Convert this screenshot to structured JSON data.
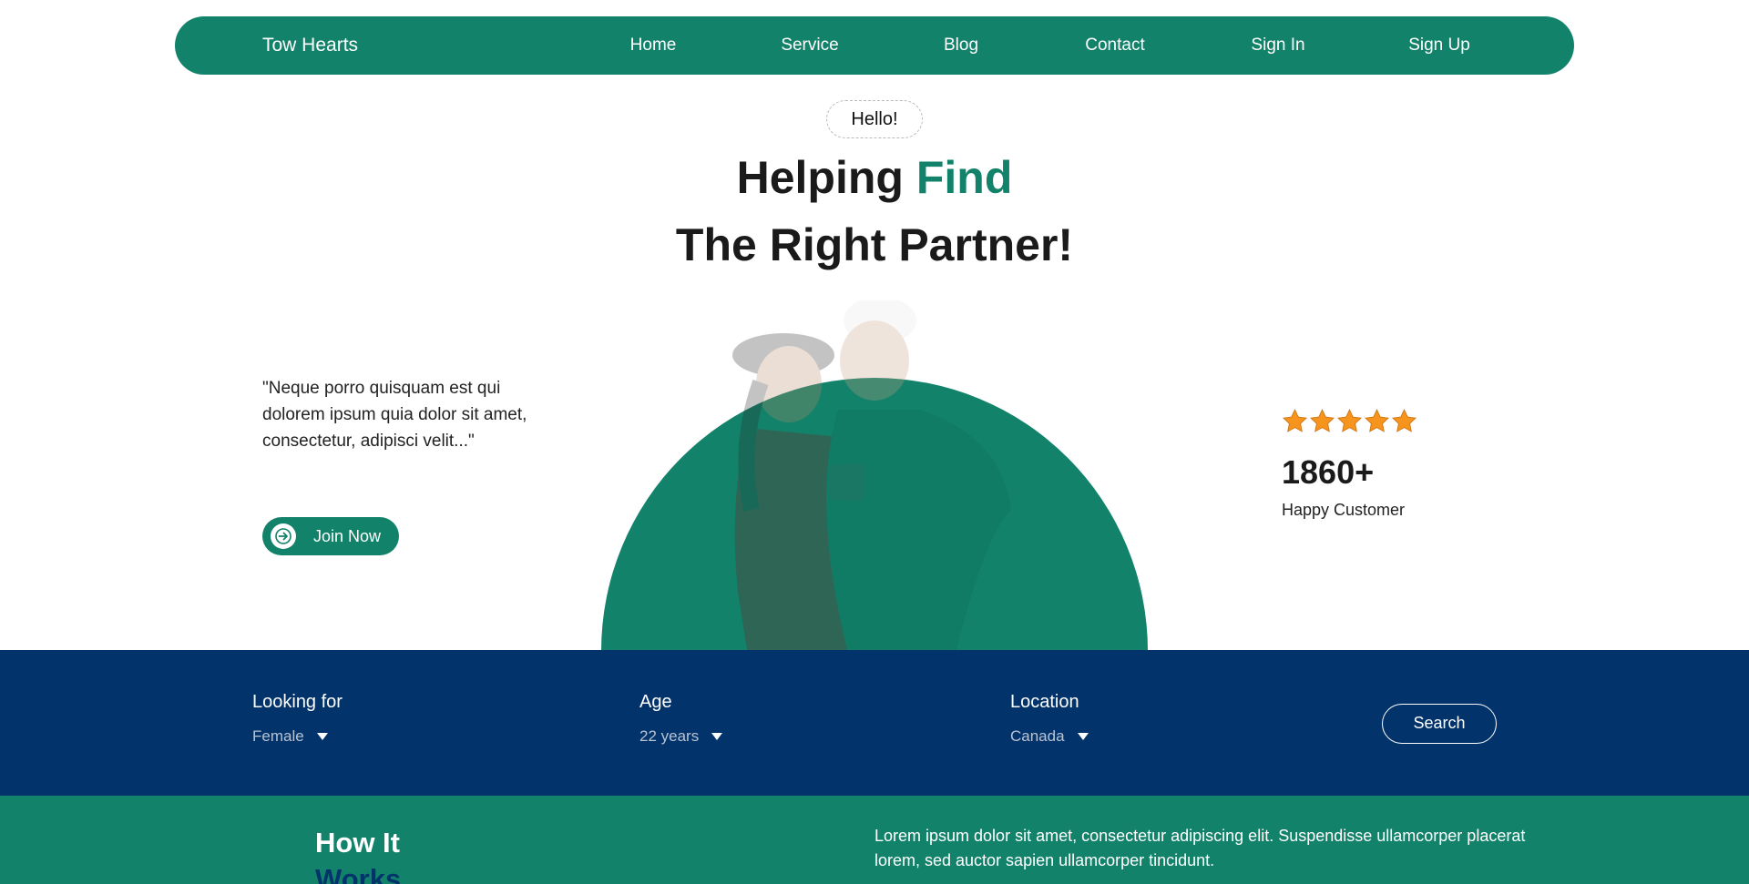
{
  "nav": {
    "brand": "Tow Hearts",
    "links": [
      "Home",
      "Service",
      "Blog",
      "Contact",
      "Sign In",
      "Sign Up"
    ]
  },
  "hero": {
    "greeting": "Hello!",
    "title_part1": "Helping ",
    "title_accent": "Find",
    "title_line2": "The Right Partner!",
    "quote": "\"Neque porro quisquam est qui dolorem ipsum quia dolor sit amet, consectetur, adipisci velit...\"",
    "join_label": "Join Now",
    "rating_stars": 5,
    "customer_count": "1860+",
    "customer_label": "Happy Customer"
  },
  "search": {
    "looking_for": {
      "label": "Looking for",
      "value": "Female"
    },
    "age": {
      "label": "Age",
      "value": "22 years"
    },
    "location": {
      "label": "Location",
      "value": "Canada"
    },
    "button": "Search"
  },
  "how": {
    "title_line1": "How It",
    "title_line2": "Works",
    "description": "Lorem ipsum dolor sit amet, consectetur adipiscing elit. Suspendisse ullamcorper placerat lorem, sed auctor sapien ullamcorper tincidunt."
  },
  "colors": {
    "primary_green": "#12826a",
    "navy": "#02336a",
    "star": "#f7941d"
  }
}
